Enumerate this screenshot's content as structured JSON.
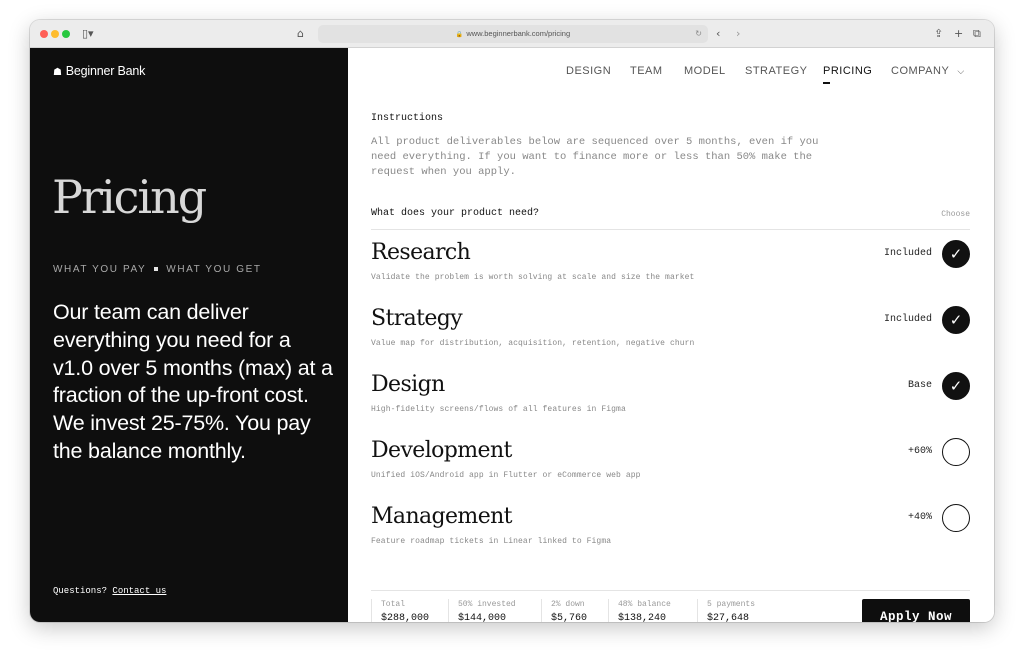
{
  "browser": {
    "url": "www.beginnerbank.com/pricing"
  },
  "brand": {
    "name": "Beginner Bank"
  },
  "nav": {
    "items": [
      "DESIGN",
      "TEAM",
      "MODEL",
      "STRATEGY",
      "PRICING",
      "COMPANY"
    ],
    "active": "PRICING"
  },
  "hero": {
    "title": "Pricing",
    "tagline_left": "WHAT YOU PAY",
    "tagline_right": "WHAT YOU GET",
    "body": "Our team can deliver everything you need for a v1.0 over 5 months (max) at a fraction of the up-front cost. We invest 25-75%. You pay the balance monthly."
  },
  "contact": {
    "question": "Questions?",
    "link": "Contact us"
  },
  "instructions": {
    "title": "Instructions",
    "text": "All product deliverables below are sequenced over 5 months, even if you need everything. If you want to finance more or less than 50% make the request when you apply."
  },
  "needs": {
    "question": "What does your product need?",
    "choose_label": "Choose"
  },
  "services": [
    {
      "name": "Research",
      "description": "Validate the problem is worth solving at scale and size the market",
      "status": "Included",
      "selected": true
    },
    {
      "name": "Strategy",
      "description": "Value map for distribution, acquisition, retention, negative churn",
      "status": "Included",
      "selected": true
    },
    {
      "name": "Design",
      "description": "High-fidelity screens/flows of all features in Figma",
      "status": "Base",
      "selected": true
    },
    {
      "name": "Development",
      "description": "Unified iOS/Android app in Flutter or eCommerce web app",
      "status": "+60%",
      "selected": false
    },
    {
      "name": "Management",
      "description": "Feature roadmap tickets in Linear linked to Figma",
      "status": "+40%",
      "selected": false
    }
  ],
  "summary": [
    {
      "label": "Total",
      "value": "$288,000"
    },
    {
      "label": "50% invested",
      "value": "$144,000"
    },
    {
      "label": "2% down",
      "value": "$5,760"
    },
    {
      "label": "48% balance",
      "value": "$138,240"
    },
    {
      "label": "5 payments",
      "value": "$27,648"
    }
  ],
  "apply_label": "Apply Now"
}
